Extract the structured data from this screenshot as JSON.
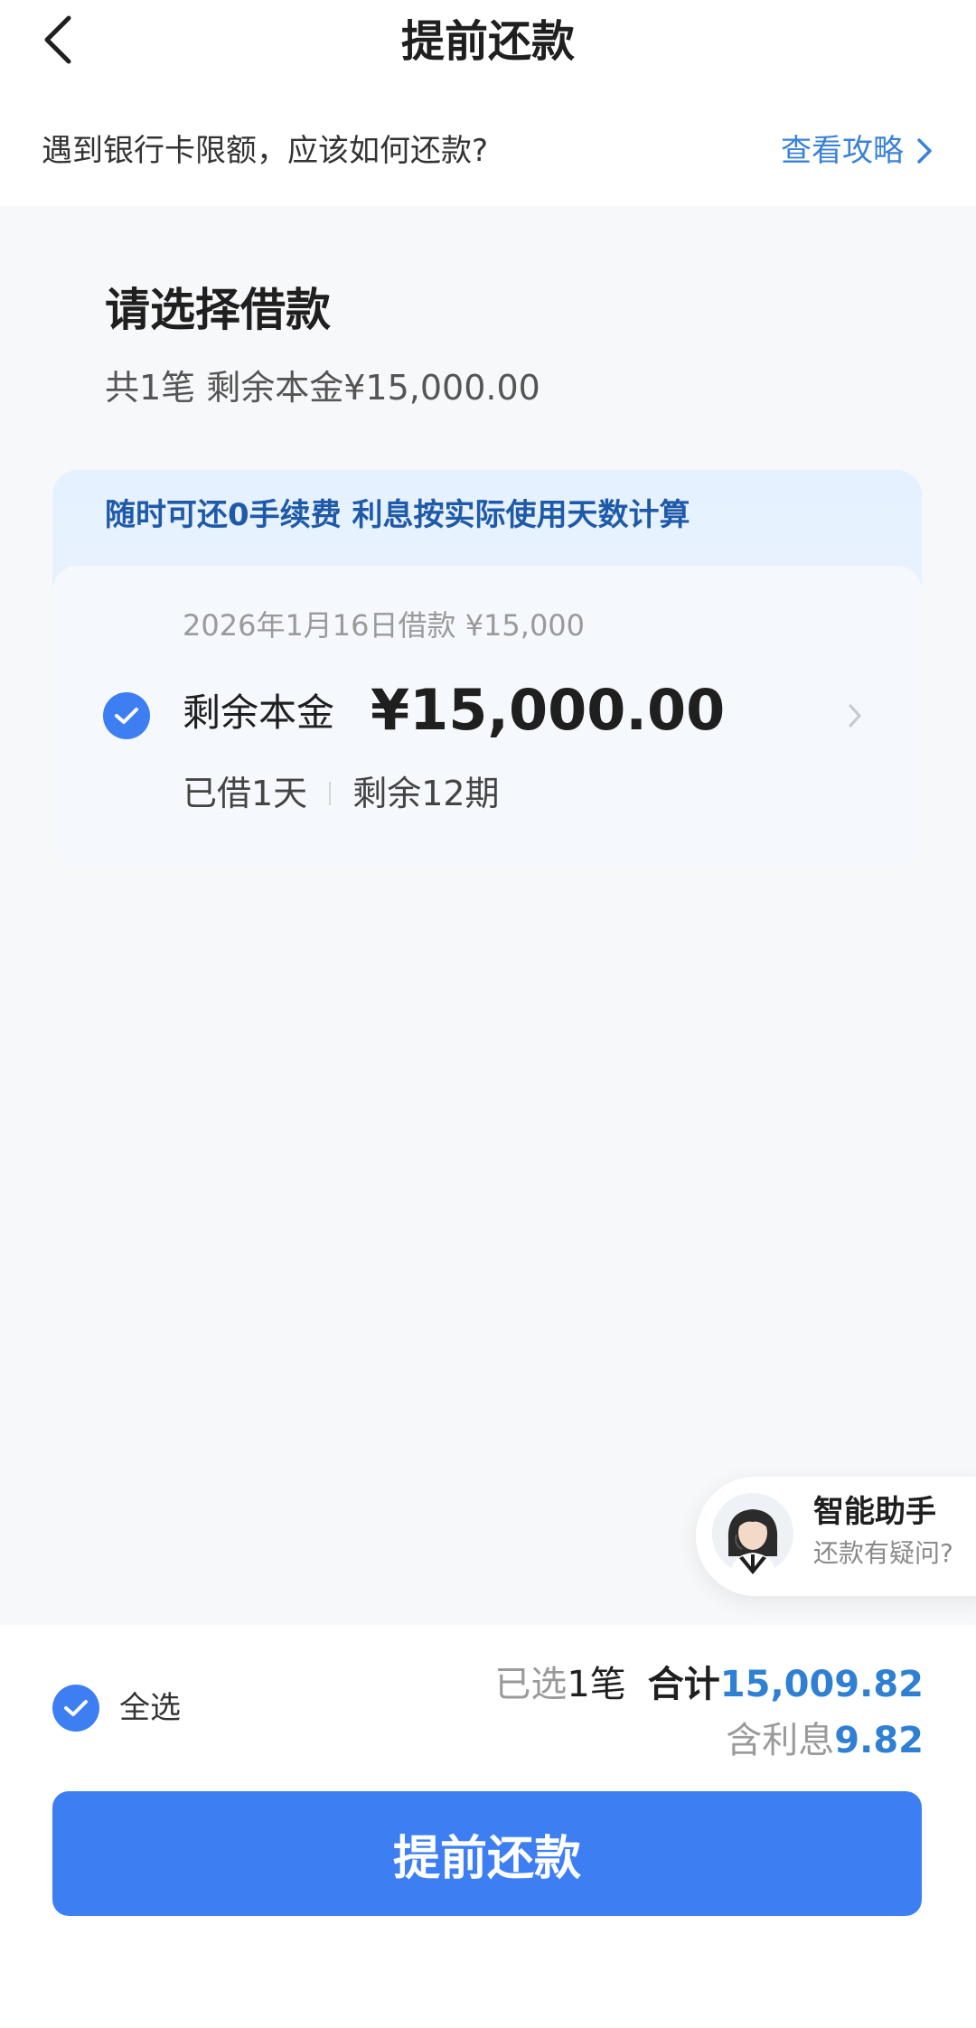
{
  "header": {
    "title": "提前还款",
    "back_icon": "chevron-left-icon"
  },
  "notice": {
    "text": "遇到银行卡限额，应该如何还款?",
    "link": "查看攻略"
  },
  "section": {
    "title": "请选择借款",
    "summary": "共1笔 剩余本金¥15,000.00"
  },
  "loan": {
    "banner": "随时可还0手续费 利息按实际使用天数计算",
    "date_line": "2026年1月16日借款 ¥15,000",
    "label": "剩余本金",
    "amount": "¥15,000.00",
    "days_borrowed": "已借1天",
    "remaining_periods": "剩余12期",
    "selected": true
  },
  "assistant": {
    "title": "智能助手",
    "subtitle": "还款有疑问?"
  },
  "footer": {
    "select_all_label": "全选",
    "selected_prefix": "已选",
    "selected_count": "1",
    "selected_suffix": "笔",
    "total_label": "合计",
    "total_value": "15,009.82",
    "interest_label": "含利息",
    "interest_value": "9.82",
    "submit_label": "提前还款"
  },
  "colors": {
    "primary": "#3d7ff2",
    "link": "#3b82d6",
    "amount_accent": "#2f7fd3",
    "banner_text": "#1f5aa8",
    "page_bg": "#f7f8fa"
  }
}
